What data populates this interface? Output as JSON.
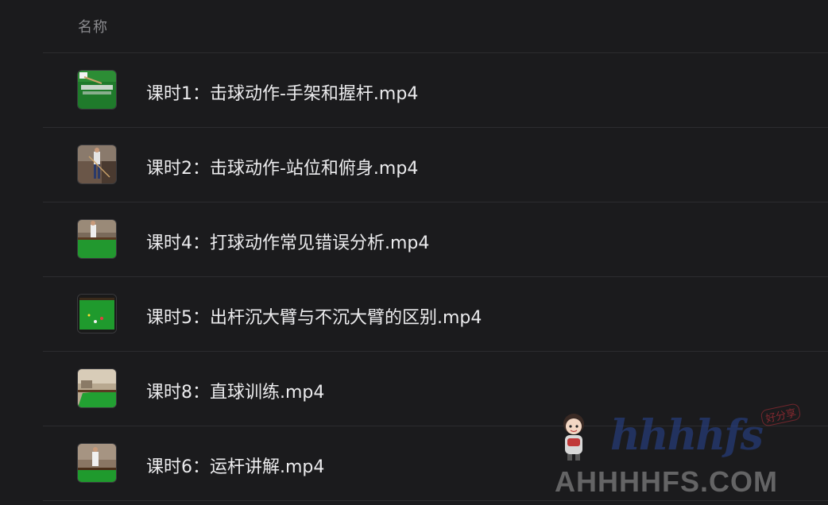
{
  "header": {
    "name_label": "名称"
  },
  "files": [
    {
      "name": "课时1：击球动作-手架和握杆.mp4",
      "thumb": "hands-on-table"
    },
    {
      "name": "课时2：击球动作-站位和俯身.mp4",
      "thumb": "player-standing"
    },
    {
      "name": "课时4：打球动作常见错误分析.mp4",
      "thumb": "table-player"
    },
    {
      "name": "课时5：出杆沉大臂与不沉大臂的区别.mp4",
      "thumb": "table-overhead"
    },
    {
      "name": "课时8：直球训练.mp4",
      "thumb": "room-with-table"
    },
    {
      "name": "课时6：运杆讲解.mp4",
      "thumb": "player-at-table"
    }
  ],
  "watermark": {
    "script": "hhhhfs",
    "tag": "好分享",
    "domain": "AHHHHFS.COM"
  },
  "colors": {
    "background": "#1b1b1d",
    "divider": "#2c2c2f",
    "text": "#ececee",
    "header_text": "#8a8a8e",
    "table_green": "#1e8a2e"
  }
}
